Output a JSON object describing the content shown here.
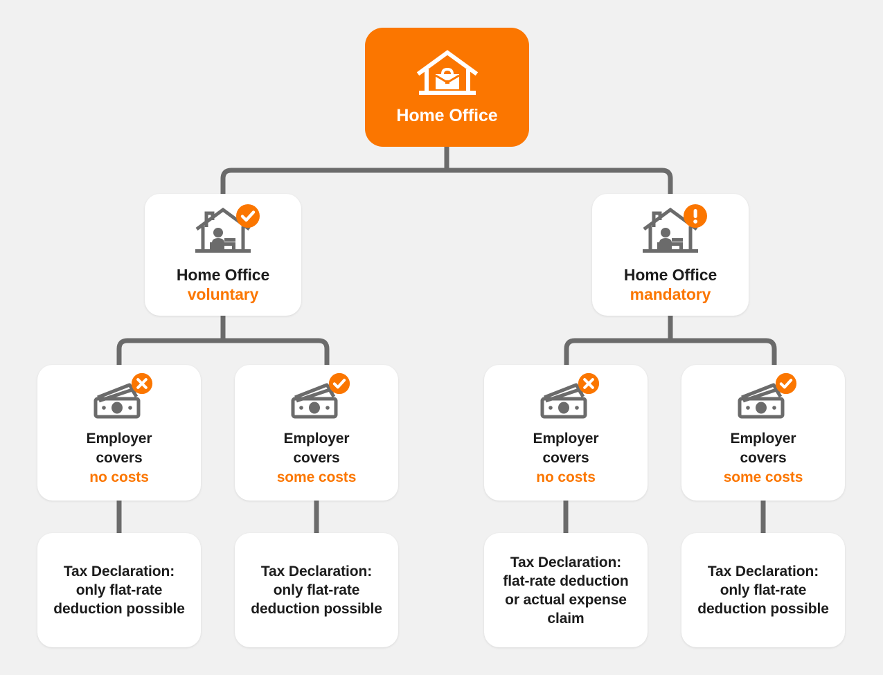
{
  "diagram": {
    "title": "Home Office tax deduction decision tree",
    "background_color": "#f1f1f1",
    "accent_color": "#fb7600",
    "text_color": "#1c1c1c",
    "card_color": "#ffffff",
    "connector_color": "#6b6b6b"
  },
  "root": {
    "title": "Home Office",
    "icon": "house-briefcase-icon",
    "badge": null
  },
  "level2": [
    {
      "title": "Home Office",
      "status": "voluntary",
      "icon": "house-person-desk-icon",
      "badge": "check-badge-icon"
    },
    {
      "title": "Home Office",
      "status": "mandatory",
      "icon": "house-person-desk-icon",
      "badge": "exclamation-badge-icon"
    }
  ],
  "level3": [
    {
      "line1": "Employer",
      "line2": "covers",
      "status": "no costs",
      "icon": "banknotes-icon",
      "badge": "cross-badge-icon"
    },
    {
      "line1": "Employer",
      "line2": "covers",
      "status": "some costs",
      "icon": "banknotes-icon",
      "badge": "check-badge-icon"
    },
    {
      "line1": "Employer",
      "line2": "covers",
      "status": "no costs",
      "icon": "banknotes-icon",
      "badge": "cross-badge-icon"
    },
    {
      "line1": "Employer",
      "line2": "covers",
      "status": "some costs",
      "icon": "banknotes-icon",
      "badge": "check-badge-icon"
    }
  ],
  "level4": [
    {
      "lines": [
        "Tax Declaration:",
        "only flat-rate",
        "deduction possible"
      ]
    },
    {
      "lines": [
        "Tax Declaration:",
        "only flat-rate",
        "deduction possible"
      ]
    },
    {
      "lines": [
        "Tax Declaration:",
        "flat-rate deduction",
        "or actual expense",
        "claim"
      ]
    },
    {
      "lines": [
        "Tax Declaration:",
        "only flat-rate",
        "deduction possible"
      ]
    }
  ],
  "level4_text": {
    "a0": "Tax Declaration:",
    "a1": "only flat-rate",
    "a2": "deduction possible",
    "b0": "Tax Declaration:",
    "b1": "only flat-rate",
    "b2": "deduction possible",
    "c0": "Tax Declaration:",
    "c1": "flat-rate deduction",
    "c2": "or actual expense",
    "c3": "claim",
    "d0": "Tax Declaration:",
    "d1": "only flat-rate",
    "d2": "deduction possible"
  }
}
